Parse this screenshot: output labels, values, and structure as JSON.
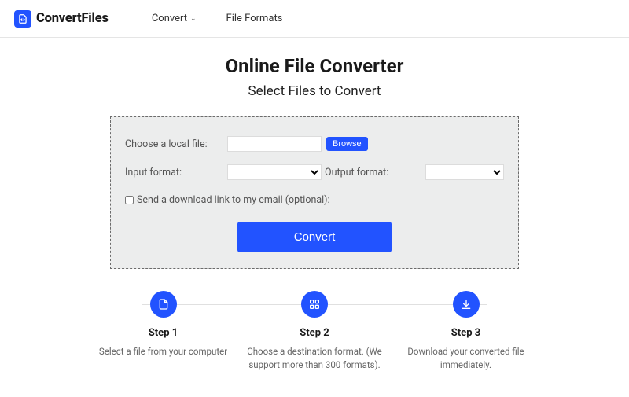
{
  "header": {
    "brand": "ConvertFiles",
    "nav": {
      "convert": "Convert",
      "formats": "File Formats"
    }
  },
  "hero": {
    "title": "Online File Converter",
    "subtitle": "Select Files to Convert"
  },
  "form": {
    "choose_label": "Choose a local file:",
    "browse": "Browse",
    "input_format_label": "Input format:",
    "output_format_label": "Output format:",
    "email_label": "Send a download link to my email (optional):",
    "convert": "Convert"
  },
  "steps": [
    {
      "title": "Step 1",
      "desc": "Select a file from your computer"
    },
    {
      "title": "Step 2",
      "desc": "Choose a destination format. (We support more than 300 formats)."
    },
    {
      "title": "Step 3",
      "desc": "Download your converted file immediately."
    }
  ]
}
